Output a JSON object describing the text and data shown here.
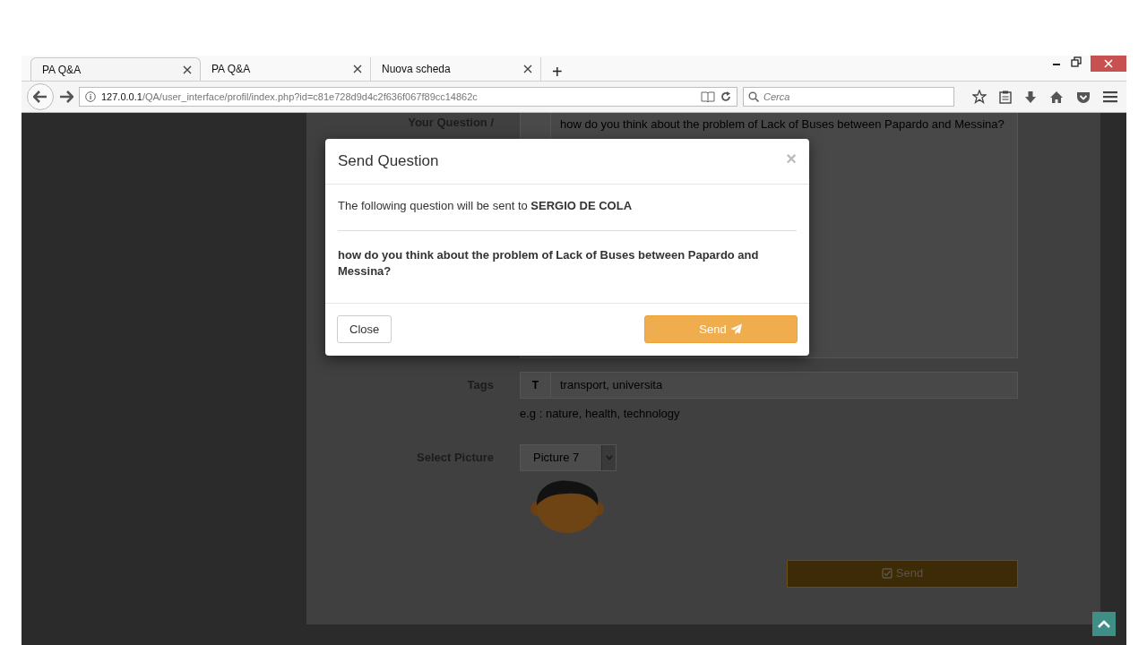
{
  "browser": {
    "tabs": [
      {
        "label": "PA Q&A",
        "selected": true
      },
      {
        "label": "PA Q&A",
        "selected": false
      },
      {
        "label": "Nuova scheda",
        "selected": false
      }
    ],
    "new_tab": "+",
    "address_host": "127.0.0.1",
    "address_path": "/QA/user_interface/profil/index.php?id=c81e728d9d4c2f636f067f89cc14862c",
    "search": {
      "placeholder": "Cerca"
    }
  },
  "form": {
    "question_label": "Your Question /",
    "question_value": "how do you think about the problem of Lack of Buses between Papardo and Messina?",
    "tags_label": "Tags",
    "tags_addon": "T",
    "tags_value": "transport, universita",
    "tags_help": "e.g : nature, health, technology",
    "picture_label": "Select Picture",
    "picture_value": "Picture 7",
    "submit": "Send"
  },
  "modal": {
    "title": "Send Question",
    "close": "×",
    "intro": "The following question will be sent to **SERGIO DE COLA**",
    "question": "how do you think about the problem of Lack of Buses between Papardo and Messina?",
    "buttons": [
      {
        "label": "Close",
        "kind": "default"
      },
      {
        "label": "Send",
        "kind": "primary"
      }
    ]
  }
}
